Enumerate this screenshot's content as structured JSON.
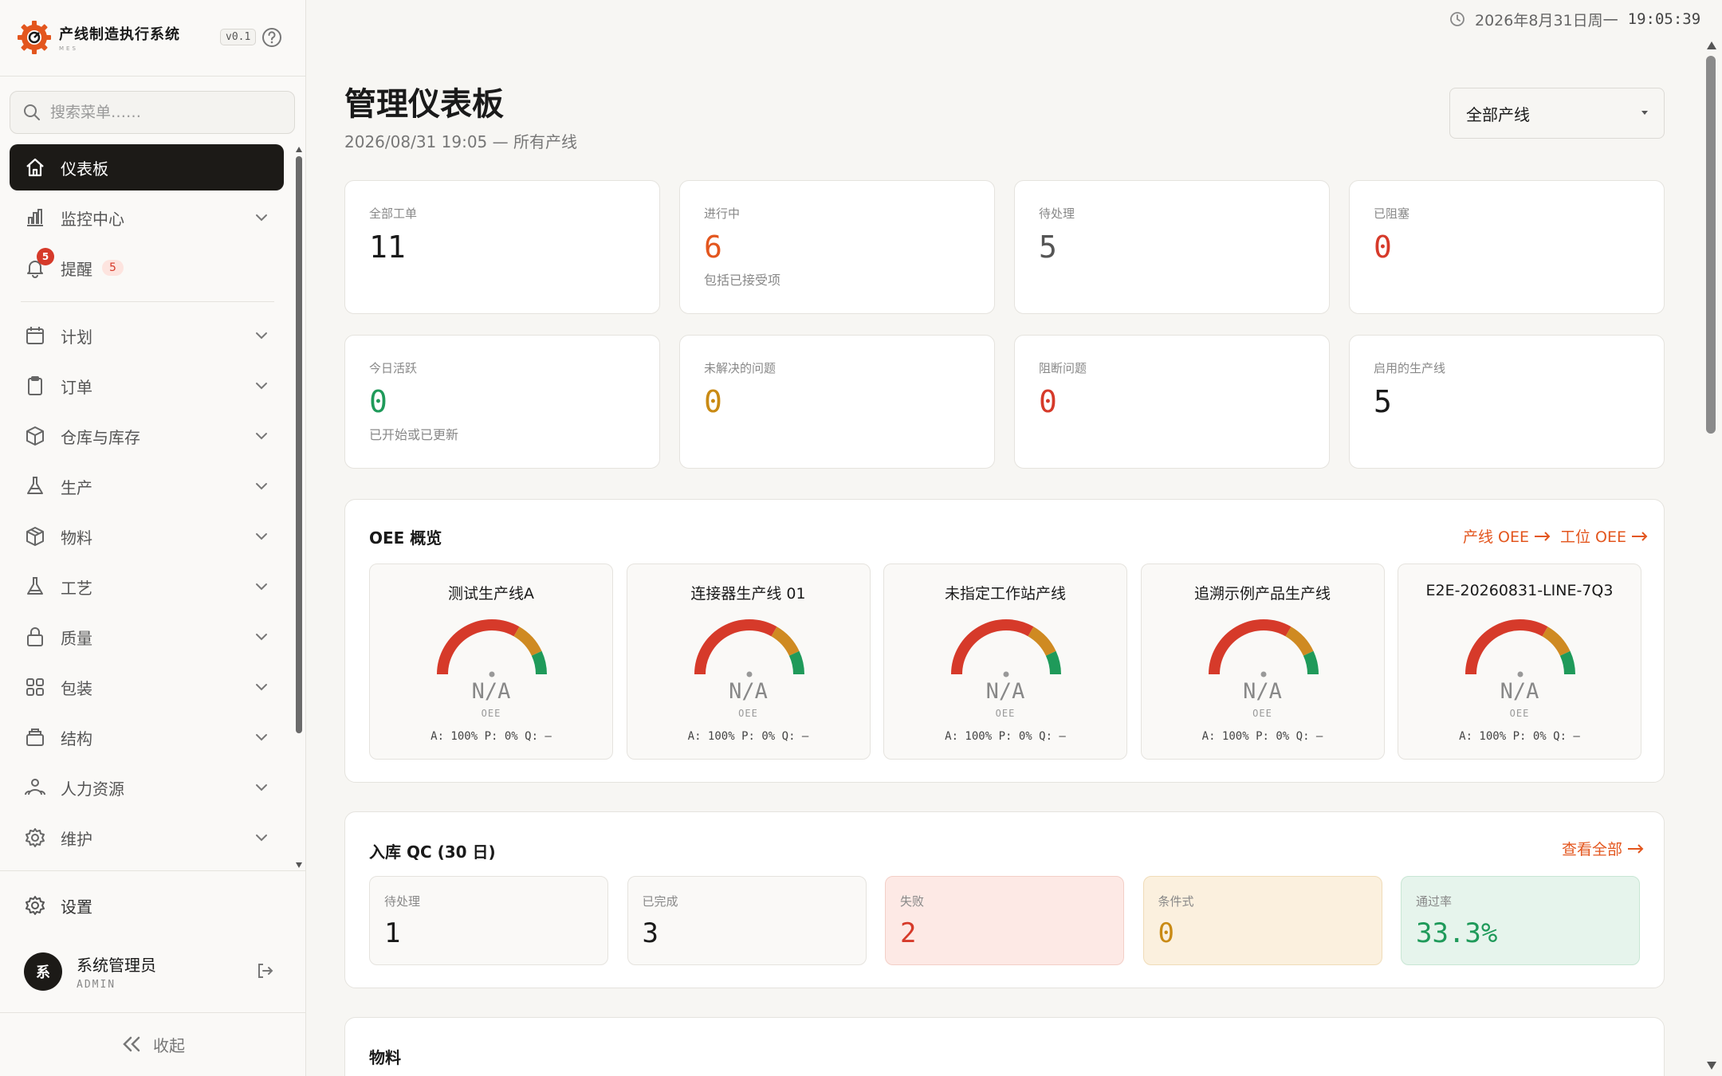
{
  "brand": {
    "title": "产线制造执行系统",
    "sub": "MES",
    "version": "v0.1"
  },
  "search": {
    "placeholder": "搜索菜单……"
  },
  "nav": [
    {
      "label": "仪表板",
      "icon": "home-icon",
      "active": true
    },
    {
      "label": "监控中心",
      "icon": "bar-chart-icon"
    },
    {
      "label": "提醒",
      "icon": "bell-icon",
      "badge": "5",
      "count": "5"
    },
    {
      "label": "计划",
      "icon": "calendar-icon"
    },
    {
      "label": "订单",
      "icon": "clipboard-icon"
    },
    {
      "label": "仓库与库存",
      "icon": "box-icon"
    },
    {
      "label": "生产",
      "icon": "flask-icon"
    },
    {
      "label": "物料",
      "icon": "package-icon"
    },
    {
      "label": "工艺",
      "icon": "beaker-icon"
    },
    {
      "label": "质量",
      "icon": "lock-icon"
    },
    {
      "label": "包装",
      "icon": "grid-icon"
    },
    {
      "label": "结构",
      "icon": "layers-icon"
    },
    {
      "label": "人力资源",
      "icon": "people-icon"
    },
    {
      "label": "维护",
      "icon": "gear-icon"
    }
  ],
  "settings": {
    "label": "设置"
  },
  "user": {
    "avatar": "系",
    "name": "系统管理员",
    "role": "ADMIN"
  },
  "collapse": {
    "label": "收起"
  },
  "clock": {
    "date": "2026年8月31日周一",
    "time": "19:05:39"
  },
  "header": {
    "title": "管理仪表板",
    "subtitle": "2026/08/31 19:05 — 所有产线",
    "select": "全部产线"
  },
  "colors": {
    "accent": "#e3561e",
    "red": "#d63a2a",
    "amber": "#c98a14",
    "green": "#1f9a5a",
    "gray": "#555555",
    "dark": "#1a1a1a"
  },
  "stats": [
    {
      "label": "全部工单",
      "value": "11",
      "note": "",
      "color": "#1a1a1a"
    },
    {
      "label": "进行中",
      "value": "6",
      "note": "包括已接受项",
      "color": "#e3561e"
    },
    {
      "label": "待处理",
      "value": "5",
      "note": "",
      "color": "#555555"
    },
    {
      "label": "已阻塞",
      "value": "0",
      "note": "",
      "color": "#d63a2a"
    },
    {
      "label": "今日活跃",
      "value": "0",
      "note": "已开始或已更新",
      "color": "#1f9a5a"
    },
    {
      "label": "未解决的问题",
      "value": "0",
      "note": "",
      "color": "#c98a14"
    },
    {
      "label": "阻断问题",
      "value": "0",
      "note": "",
      "color": "#d63a2a"
    },
    {
      "label": "启用的生产线",
      "value": "5",
      "note": "",
      "color": "#1a1a1a"
    }
  ],
  "oee": {
    "title": "OEE 概览",
    "link_line": "产线 OEE",
    "link_station": "工位 OEE",
    "gauges": [
      {
        "name": "测试生产线A",
        "value": "N/A",
        "label": "OEE",
        "metrics": "A: 100%  P: 0%  Q: —"
      },
      {
        "name": "连接器生产线 01",
        "value": "N/A",
        "label": "OEE",
        "metrics": "A: 100%  P: 0%  Q: —"
      },
      {
        "name": "未指定工作站产线",
        "value": "N/A",
        "label": "OEE",
        "metrics": "A: 100%  P: 0%  Q: —"
      },
      {
        "name": "追溯示例产品生产线",
        "value": "N/A",
        "label": "OEE",
        "metrics": "A: 100%  P: 0%  Q: —"
      },
      {
        "name": "E2E-20260831-LINE-7Q3",
        "value": "N/A",
        "label": "OEE",
        "metrics": "A: 100%  P: 0%  Q: —"
      }
    ]
  },
  "qc": {
    "title": "入库 QC (30 日)",
    "link": "查看全部",
    "cards": [
      {
        "label": "待处理",
        "value": "1",
        "color": "#1a1a1a",
        "bg": "#faf9f7",
        "border": "#e5e3de"
      },
      {
        "label": "已完成",
        "value": "3",
        "color": "#1a1a1a",
        "bg": "#faf9f7",
        "border": "#e5e3de"
      },
      {
        "label": "失败",
        "value": "2",
        "color": "#d63a2a",
        "bg": "#fde9e5",
        "border": "#f3cfc7"
      },
      {
        "label": "条件式",
        "value": "0",
        "color": "#c98a14",
        "bg": "#fbf0de",
        "border": "#f0dcb8"
      },
      {
        "label": "通过率",
        "value": "33.3%",
        "color": "#1f9a5a",
        "bg": "#e6f4ec",
        "border": "#c8e6d4"
      }
    ]
  },
  "materials": {
    "title": "物料"
  }
}
